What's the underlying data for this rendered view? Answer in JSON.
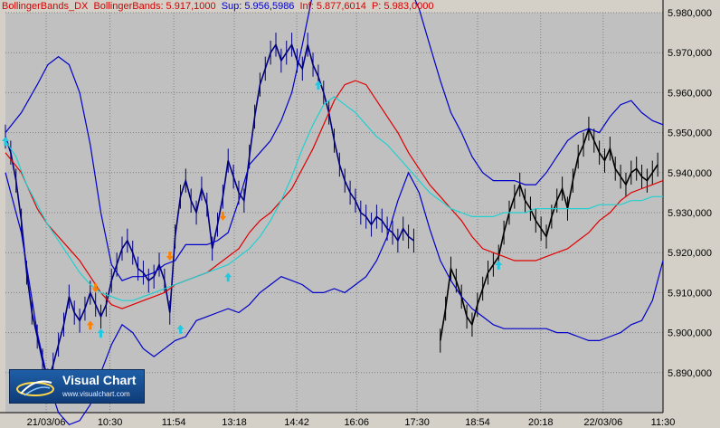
{
  "header": {
    "indicator": "BollingerBands_DX",
    "label": "BollingerBands: 5.917,1000",
    "sup": "Sup: 5.956,5986",
    "inf": "Inf: 5.877,6014",
    "p": "P: 5.983,0000",
    "colors": {
      "indicator": "#d40000",
      "label": "#d40000",
      "sup": "#0000c8",
      "inf": "#d40000",
      "p": "#d40000"
    }
  },
  "logo": {
    "name": "Visual Chart",
    "url": "www.visualchart.com"
  },
  "colors": {
    "background": "#c0c0c0",
    "price": "#000080",
    "price_late": "#000000",
    "upper_band": "#0000c8",
    "lower_band": "#0000c8",
    "middle_band": "#e00000",
    "signal_line": "#20d0d0",
    "arrow_up": "#20c8e0",
    "arrow_down": "#ff8000"
  },
  "chart_data": {
    "type": "line",
    "title": "",
    "xlabel": "",
    "ylabel": "",
    "ylim": [
      5.88,
      5.98
    ],
    "yticks": [
      5.89,
      5.9,
      5.91,
      5.92,
      5.93,
      5.94,
      5.95,
      5.96,
      5.97,
      5.98
    ],
    "ytick_labels": [
      "5.890,000",
      "5.900,000",
      "5.910,000",
      "5.920,000",
      "5.930,000",
      "5.940,000",
      "5.950,000",
      "5.960,000",
      "5.970,000",
      "5.980,000"
    ],
    "xlim": [
      0,
      100
    ],
    "xticks": [
      {
        "x": 6.2,
        "label": "21/03/06"
      },
      {
        "x": 15.9,
        "label": "10:30"
      },
      {
        "x": 25.6,
        "label": "11:54"
      },
      {
        "x": 34.8,
        "label": "13:18"
      },
      {
        "x": 44.3,
        "label": "14:42"
      },
      {
        "x": 53.4,
        "label": "16:06"
      },
      {
        "x": 62.6,
        "label": "17:30"
      },
      {
        "x": 71.8,
        "label": "18:54"
      },
      {
        "x": 81.4,
        "label": "20:18"
      },
      {
        "x": 90.9,
        "label": "22/03/06"
      },
      {
        "x": 100.0,
        "label": "11:30"
      }
    ],
    "grid": true,
    "legend": "none",
    "series": [
      {
        "role": "price",
        "x": [
          0,
          1,
          2,
          3,
          4,
          5,
          6,
          7,
          8,
          9,
          10,
          11,
          12,
          13,
          14,
          15,
          16,
          17,
          18,
          19,
          20,
          21,
          22,
          23,
          24,
          25,
          26,
          27,
          28,
          29,
          30,
          31,
          32,
          33,
          34,
          35,
          36,
          37,
          38,
          39,
          40,
          41,
          42,
          43,
          44,
          45,
          46,
          47,
          48,
          49,
          50,
          51,
          52,
          53,
          54,
          55,
          56,
          57,
          58,
          59,
          60,
          61,
          62,
          63,
          64,
          65,
          66,
          67,
          68,
          69,
          70,
          71,
          72,
          73,
          74,
          75,
          76,
          77
        ],
        "values": [
          5.949,
          5.945,
          5.938,
          5.928,
          5.915,
          5.905,
          5.899,
          5.893,
          5.888,
          5.892,
          5.897,
          5.902,
          5.909,
          5.905,
          5.903,
          5.906,
          5.91,
          5.907,
          5.904,
          5.907,
          5.913,
          5.917,
          5.921,
          5.923,
          5.92,
          5.916,
          5.915,
          5.913,
          5.914,
          5.917,
          5.913,
          5.905,
          5.924,
          5.934,
          5.938,
          5.933,
          5.93,
          5.936,
          5.932,
          5.921,
          5.927,
          5.934,
          5.943,
          5.939,
          5.935,
          5.933,
          5.944,
          5.954,
          5.962,
          5.966,
          5.97,
          5.972,
          5.968,
          5.97,
          5.972,
          5.968,
          5.966,
          5.972,
          5.967,
          5.964,
          5.96,
          5.955,
          5.948,
          5.942,
          5.938,
          5.935,
          5.933,
          5.93,
          5.929,
          5.927,
          5.929,
          5.928,
          5.926,
          5.925,
          5.923,
          5.926,
          5.924,
          5.923
        ]
      },
      {
        "role": "price_late",
        "x": [
          82,
          83,
          84,
          85,
          86,
          87,
          88,
          89,
          90,
          91,
          92,
          93,
          94,
          95,
          96,
          97,
          98,
          99,
          100,
          101,
          102,
          103,
          104,
          105,
          106,
          107,
          108,
          109,
          110,
          111,
          112,
          113,
          114,
          115,
          116,
          117,
          118,
          119,
          120,
          121,
          122,
          123
        ],
        "values": [
          5.898,
          5.906,
          5.916,
          5.913,
          5.909,
          5.904,
          5.902,
          5.907,
          5.911,
          5.915,
          5.917,
          5.919,
          5.925,
          5.93,
          5.934,
          5.937,
          5.933,
          5.931,
          5.928,
          5.926,
          5.924,
          5.929,
          5.933,
          5.936,
          5.931,
          5.938,
          5.944,
          5.947,
          5.951,
          5.948,
          5.945,
          5.943,
          5.946,
          5.941,
          5.939,
          5.937,
          5.94,
          5.941,
          5.939,
          5.938,
          5.94,
          5.942
        ]
      },
      {
        "role": "upper_band",
        "x": [
          0,
          3,
          6,
          8,
          10,
          12,
          14,
          16,
          18,
          20,
          22,
          24,
          26,
          28,
          30,
          32,
          34,
          36,
          38,
          40,
          42,
          44,
          46,
          48,
          50,
          52,
          54,
          56,
          58,
          60,
          62,
          64,
          66,
          68,
          70,
          72,
          74,
          76,
          78,
          80,
          82,
          84,
          86,
          88,
          90,
          92,
          94,
          96,
          98,
          100,
          102,
          104,
          106,
          108,
          110,
          112,
          114,
          116,
          118,
          120,
          122,
          124
        ],
        "values": [
          5.95,
          5.955,
          5.962,
          5.967,
          5.969,
          5.967,
          5.96,
          5.947,
          5.93,
          5.917,
          5.913,
          5.914,
          5.914,
          5.915,
          5.917,
          5.918,
          5.922,
          5.922,
          5.922,
          5.923,
          5.925,
          5.933,
          5.942,
          5.945,
          5.948,
          5.953,
          5.96,
          5.972,
          5.985,
          5.99,
          5.987,
          5.985,
          5.986,
          5.985,
          5.988,
          5.99,
          5.99,
          5.987,
          5.981,
          5.972,
          5.963,
          5.955,
          5.95,
          5.944,
          5.94,
          5.938,
          5.938,
          5.938,
          5.937,
          5.937,
          5.94,
          5.944,
          5.948,
          5.95,
          5.951,
          5.95,
          5.954,
          5.957,
          5.958,
          5.955,
          5.953,
          5.952
        ]
      },
      {
        "role": "lower_band",
        "x": [
          0,
          3,
          6,
          8,
          10,
          12,
          14,
          16,
          18,
          20,
          22,
          24,
          26,
          28,
          30,
          32,
          34,
          36,
          38,
          40,
          42,
          44,
          46,
          48,
          50,
          52,
          54,
          56,
          58,
          60,
          62,
          64,
          66,
          68,
          70,
          72,
          74,
          76,
          78,
          80,
          82,
          84,
          86,
          88,
          90,
          92,
          94,
          96,
          98,
          100,
          102,
          104,
          106,
          108,
          110,
          112,
          114,
          116,
          118,
          120,
          122,
          124
        ],
        "values": [
          5.94,
          5.925,
          5.9,
          5.888,
          5.88,
          5.877,
          5.878,
          5.882,
          5.89,
          5.897,
          5.902,
          5.9,
          5.896,
          5.894,
          5.896,
          5.898,
          5.899,
          5.903,
          5.904,
          5.905,
          5.906,
          5.905,
          5.907,
          5.91,
          5.912,
          5.914,
          5.913,
          5.912,
          5.91,
          5.91,
          5.911,
          5.91,
          5.912,
          5.914,
          5.918,
          5.924,
          5.933,
          5.94,
          5.935,
          5.926,
          5.918,
          5.913,
          5.909,
          5.906,
          5.904,
          5.902,
          5.901,
          5.901,
          5.901,
          5.901,
          5.901,
          5.9,
          5.9,
          5.899,
          5.898,
          5.898,
          5.899,
          5.9,
          5.902,
          5.903,
          5.908,
          5.918
        ]
      },
      {
        "role": "middle_band",
        "x": [
          0,
          3,
          6,
          8,
          10,
          12,
          14,
          16,
          18,
          20,
          22,
          24,
          26,
          28,
          30,
          32,
          34,
          36,
          38,
          40,
          42,
          44,
          46,
          48,
          50,
          52,
          54,
          56,
          58,
          60,
          62,
          64,
          66,
          68,
          70,
          72,
          74,
          76,
          78,
          80,
          82,
          84,
          86,
          88,
          90,
          92,
          94,
          96,
          98,
          100,
          102,
          104,
          106,
          108,
          110,
          112,
          114,
          116,
          118,
          120,
          122,
          124
        ],
        "values": [
          5.945,
          5.94,
          5.931,
          5.927,
          5.924,
          5.921,
          5.918,
          5.914,
          5.91,
          5.907,
          5.906,
          5.907,
          5.908,
          5.909,
          5.91,
          5.912,
          5.913,
          5.914,
          5.915,
          5.917,
          5.919,
          5.921,
          5.925,
          5.928,
          5.93,
          5.933,
          5.936,
          5.941,
          5.946,
          5.952,
          5.958,
          5.962,
          5.963,
          5.962,
          5.958,
          5.954,
          5.95,
          5.945,
          5.941,
          5.937,
          5.934,
          5.931,
          5.928,
          5.924,
          5.921,
          5.92,
          5.919,
          5.918,
          5.918,
          5.918,
          5.919,
          5.92,
          5.921,
          5.923,
          5.925,
          5.928,
          5.93,
          5.933,
          5.935,
          5.936,
          5.937,
          5.938
        ]
      },
      {
        "role": "signal_line",
        "x": [
          0,
          2,
          4,
          6,
          8,
          10,
          12,
          14,
          16,
          18,
          20,
          22,
          24,
          26,
          28,
          30,
          32,
          34,
          36,
          38,
          40,
          42,
          44,
          46,
          48,
          50,
          52,
          54,
          56,
          58,
          60,
          62,
          64,
          66,
          68,
          70,
          72,
          74,
          76,
          78,
          80,
          82,
          84,
          86,
          88,
          90,
          92,
          94,
          96,
          98,
          100,
          102,
          104,
          106,
          108,
          110,
          112,
          114,
          116,
          118,
          120,
          122,
          124
        ],
        "values": [
          5.948,
          5.944,
          5.937,
          5.932,
          5.927,
          5.923,
          5.919,
          5.915,
          5.912,
          5.91,
          5.909,
          5.908,
          5.908,
          5.909,
          5.91,
          5.911,
          5.912,
          5.913,
          5.914,
          5.915,
          5.916,
          5.917,
          5.919,
          5.921,
          5.924,
          5.928,
          5.933,
          5.939,
          5.946,
          5.952,
          5.957,
          5.959,
          5.957,
          5.955,
          5.952,
          5.949,
          5.947,
          5.944,
          5.941,
          5.938,
          5.935,
          5.933,
          5.931,
          5.93,
          5.929,
          5.929,
          5.929,
          5.93,
          5.93,
          5.93,
          5.931,
          5.931,
          5.931,
          5.931,
          5.931,
          5.931,
          5.932,
          5.932,
          5.932,
          5.933,
          5.933,
          5.934,
          5.934
        ]
      }
    ],
    "markers": [
      {
        "type": "up",
        "x": 0,
        "y": 5.949,
        "color": "cyan"
      },
      {
        "type": "down",
        "x": 17,
        "y": 5.91,
        "color": "orange"
      },
      {
        "type": "up",
        "x": 16,
        "y": 5.903,
        "color": "orange"
      },
      {
        "type": "up",
        "x": 18,
        "y": 5.901,
        "color": "cyan"
      },
      {
        "type": "down",
        "x": 31,
        "y": 5.918,
        "color": "orange"
      },
      {
        "type": "up",
        "x": 33,
        "y": 5.902,
        "color": "cyan"
      },
      {
        "type": "down",
        "x": 41,
        "y": 5.928,
        "color": "orange"
      },
      {
        "type": "up",
        "x": 42,
        "y": 5.915,
        "color": "cyan"
      },
      {
        "type": "up",
        "x": 59,
        "y": 5.963,
        "color": "cyan"
      },
      {
        "type": "up",
        "x": 93,
        "y": 5.918,
        "color": "cyan"
      }
    ]
  }
}
